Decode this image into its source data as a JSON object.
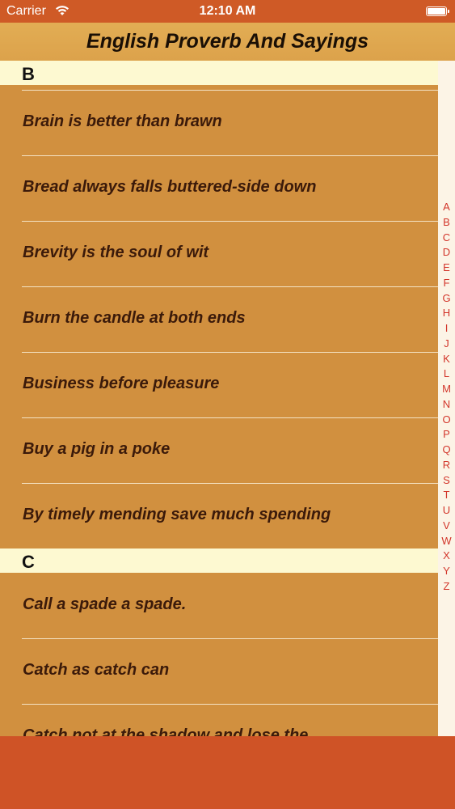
{
  "status_bar": {
    "carrier": "Carrier",
    "time": "12:10 AM"
  },
  "nav": {
    "title": "English Proverb And Sayings"
  },
  "sections": [
    {
      "letter": "B",
      "items": [
        "Brain is better than brawn",
        "Bread always falls buttered-side down",
        "Brevity is the soul of wit",
        "Burn the candle at both ends",
        "Business before pleasure",
        "Buy a pig in a poke",
        "By timely mending save much spending"
      ]
    },
    {
      "letter": "C",
      "items": [
        "Call a spade a spade.",
        "Catch as catch can",
        "Catch not at the shadow and lose the"
      ]
    }
  ],
  "index_letters": [
    "A",
    "B",
    "C",
    "D",
    "E",
    "F",
    "G",
    "H",
    "I",
    "J",
    "K",
    "L",
    "M",
    "N",
    "O",
    "P",
    "Q",
    "R",
    "S",
    "T",
    "U",
    "V",
    "W",
    "X",
    "Y",
    "Z"
  ],
  "colors": {
    "status_bar": "#cf5a26",
    "nav_bar": "#dfa850",
    "list_bg": "#d1903f",
    "section_header": "#fdf9d1",
    "index_letter": "#d2352a",
    "bottom_bar": "#cf5326"
  }
}
